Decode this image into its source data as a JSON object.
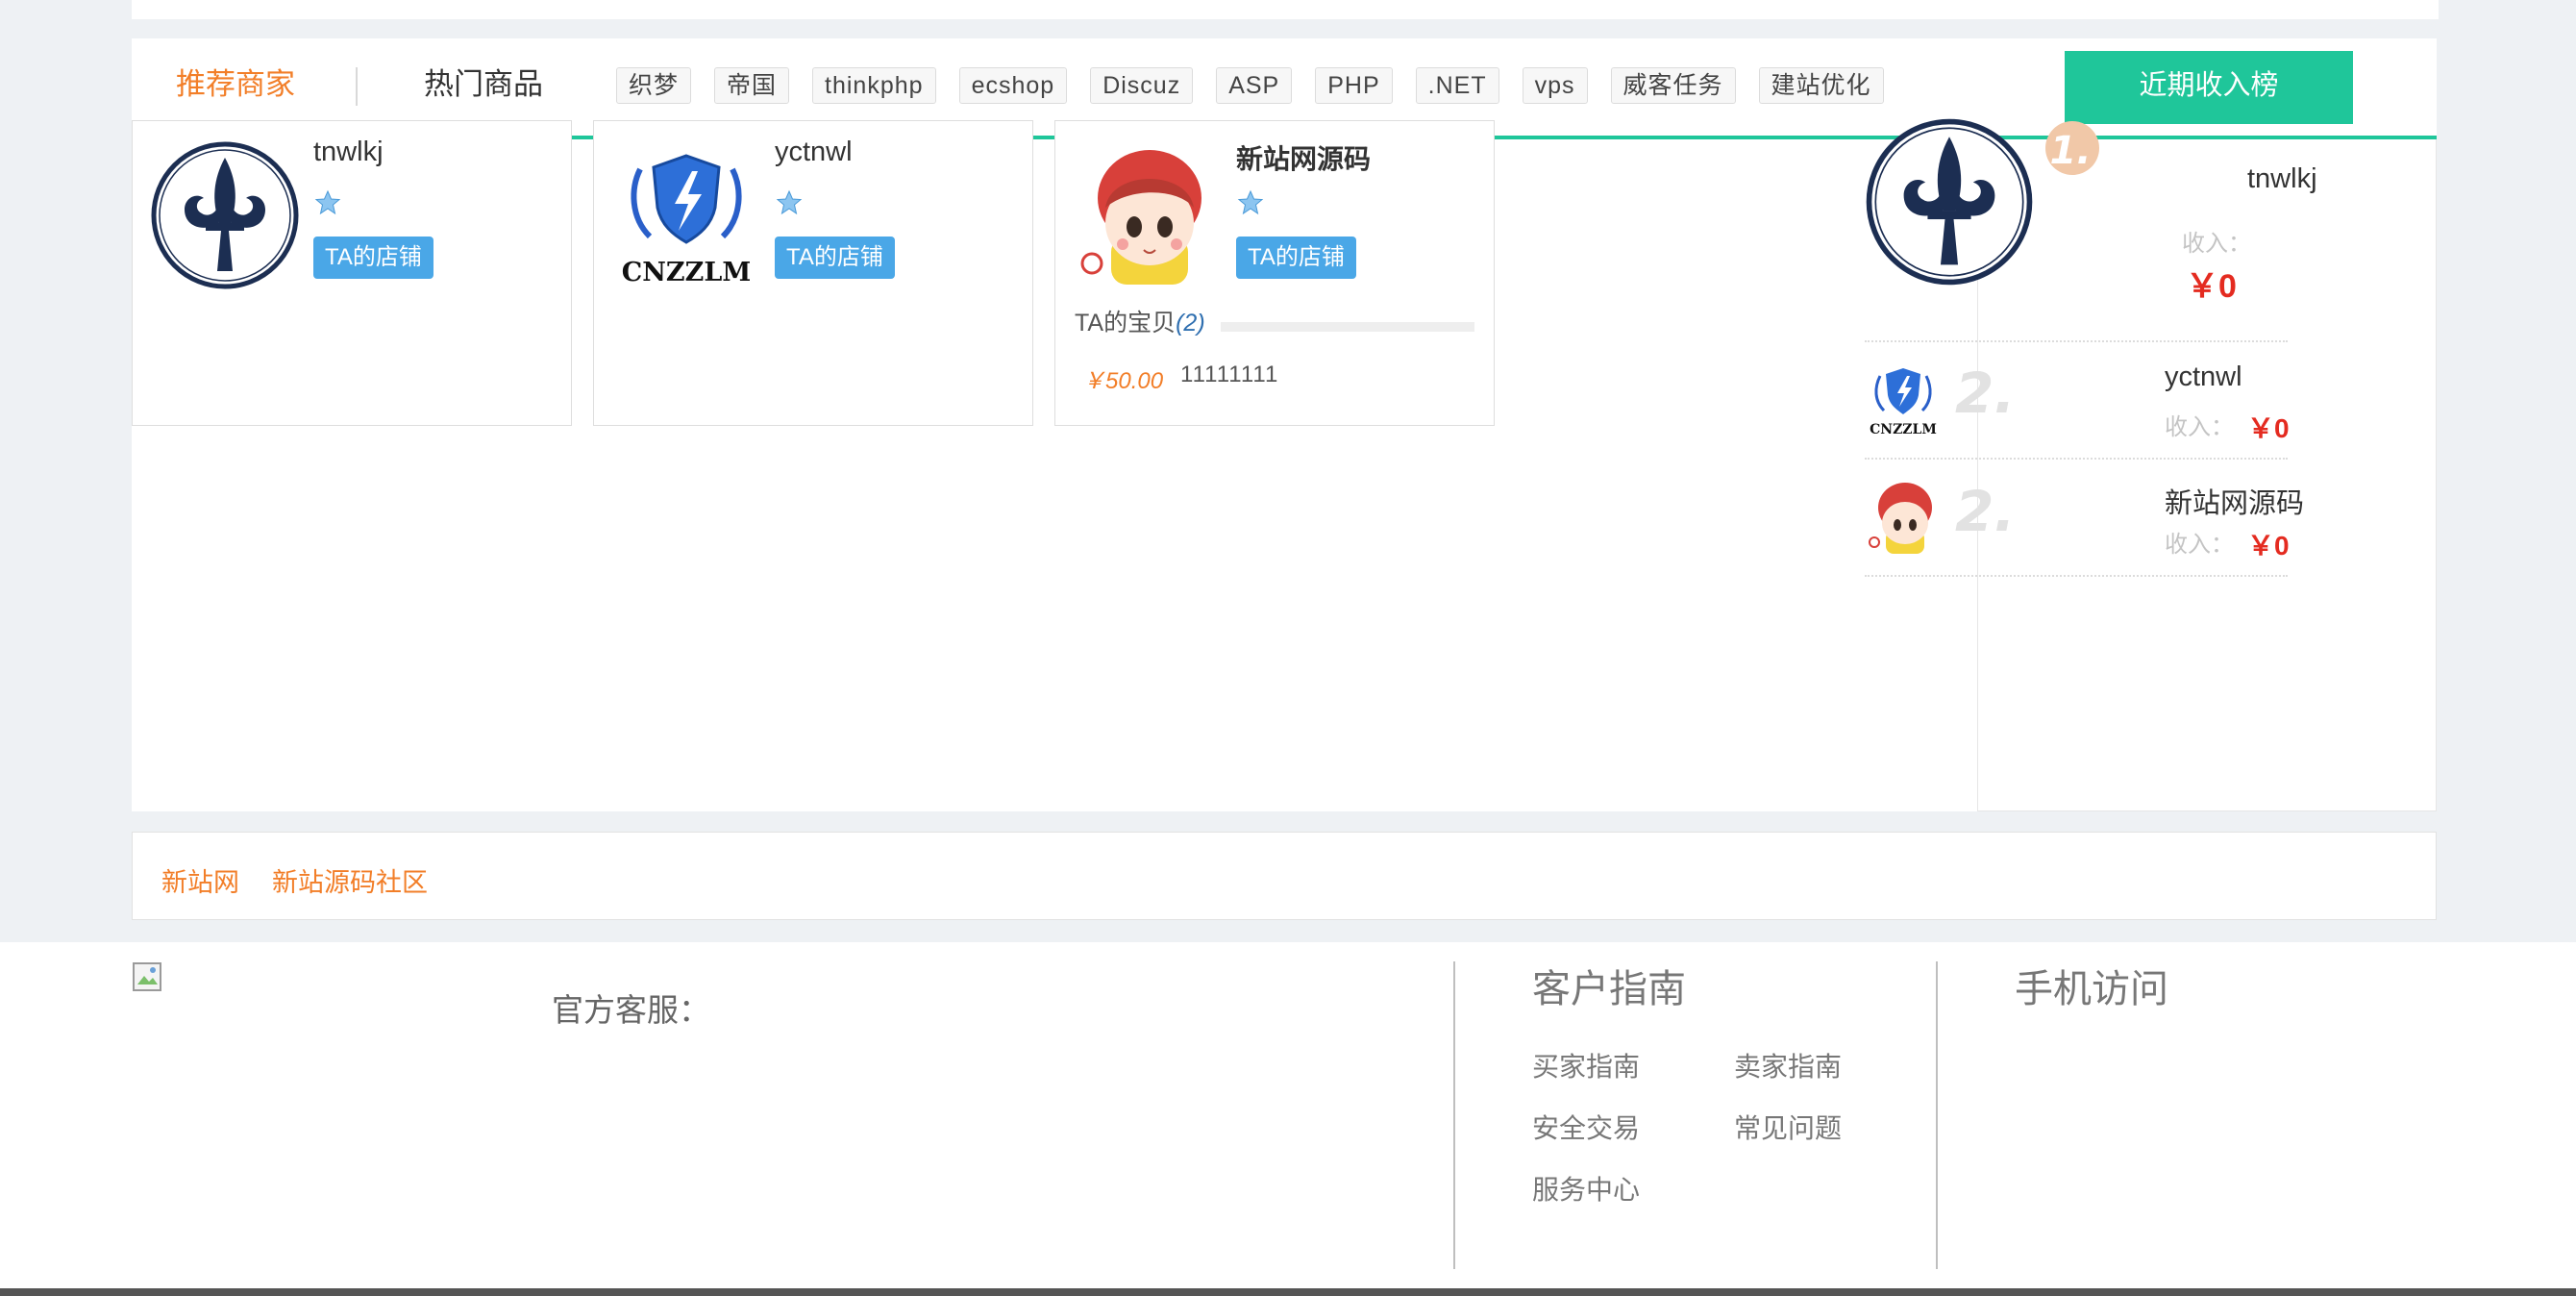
{
  "tabs": {
    "active": "推荐商家",
    "second": "热门商品"
  },
  "tags": [
    "织梦",
    "帝国",
    "thinkphp",
    "ecshop",
    "Discuz",
    "ASP",
    "PHP",
    ".NET",
    "vps",
    "威客任务",
    "建站优化"
  ],
  "rank_button": "近期收入榜",
  "shops": [
    {
      "name": "tnwlkj",
      "shop_button": "TA的店铺",
      "logo_icon": "fleur-de-lis-icon"
    },
    {
      "name": "yctnwl",
      "shop_button": "TA的店铺",
      "logo_icon": "cnzzlm-shield-icon",
      "logo_text": "CNZZLM"
    },
    {
      "name": "新站网源码",
      "shop_button": "TA的店铺",
      "logo_icon": "cartoon-girl-icon",
      "baby_label": "TA的宝贝",
      "baby_count": "(2)",
      "goods": {
        "price": "￥50.00",
        "name": "11111111"
      }
    }
  ],
  "ranking": [
    {
      "rank": "1.",
      "name": "tnwlkj",
      "income_label": "收入：",
      "income": "￥0"
    },
    {
      "rank": "2.",
      "name": "yctnwl",
      "income_label": "收入：",
      "income": "￥0"
    },
    {
      "rank": "2.",
      "name": "新站网源码",
      "income_label": "收入：",
      "income": "￥0"
    }
  ],
  "links": [
    "新站网",
    "新站源码社区"
  ],
  "footer": {
    "service_label": "官方客服：",
    "guide_title": "客户指南",
    "guide_links": [
      "买家指南",
      "卖家指南",
      "安全交易",
      "常见问题",
      "服务中心"
    ],
    "mobile_title": "手机访问"
  },
  "colors": {
    "accent_orange": "#f27e28",
    "accent_green": "#1fc69a",
    "shop_button_blue": "#4aa7e7",
    "money_red": "#e42b20"
  }
}
